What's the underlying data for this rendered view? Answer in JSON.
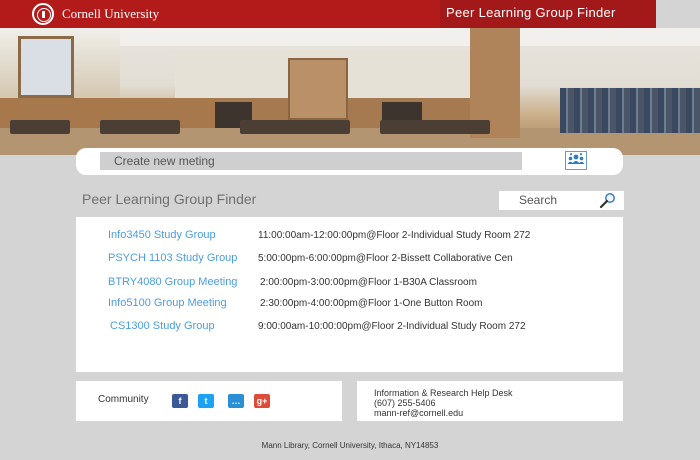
{
  "header": {
    "university_name": "Cornell University",
    "app_title": "Peer Learning Group Finder",
    "brand_color": "#b31b1b"
  },
  "create": {
    "placeholder": "Create new meting",
    "icon": "people-group-icon"
  },
  "main": {
    "section_title": "Peer Learning Group Finder",
    "search_label": "Search",
    "search_icon": "magnifier-icon",
    "groups": [
      {
        "name": "Info3450 Study Group",
        "detail": "11:00:00am-12:00:00pm@Floor 2-Individual Study Room 272"
      },
      {
        "name": "PSYCH 1103 Study Group",
        "detail": "5:00:00pm-6:00:00pm@Floor 2-Bissett Collaborative Cen"
      },
      {
        "name": "BTRY4080 Group Meeting",
        "detail": "2:00:00pm-3:00:00pm@Floor 1-B30A Classroom"
      },
      {
        "name": "Info5100 Group Meeting",
        "detail": "2:30:00pm-4:00:00pm@Floor 1-One Button Room"
      },
      {
        "name": "CS1300 Study Group",
        "detail": "9:00:00am-10:00:00pm@Floor 2-Individual Study Room 272"
      }
    ]
  },
  "community": {
    "label": "Community",
    "icons": [
      {
        "name": "facebook-icon",
        "glyph": "f",
        "color": "#3b5998"
      },
      {
        "name": "twitter-icon",
        "glyph": "t",
        "color": "#1da1f2"
      },
      {
        "name": "chat-icon",
        "glyph": "…",
        "color": "#2b8fd6"
      },
      {
        "name": "googleplus-icon",
        "glyph": "g+",
        "color": "#dd4b39"
      }
    ]
  },
  "helpdesk": {
    "title": "Information & Research Help Desk",
    "phone": "(607) 255-5406",
    "email": "mann-ref@cornell.edu"
  },
  "footer": {
    "address": "Mann Library, Cornell University, Ithaca, NY14853"
  }
}
